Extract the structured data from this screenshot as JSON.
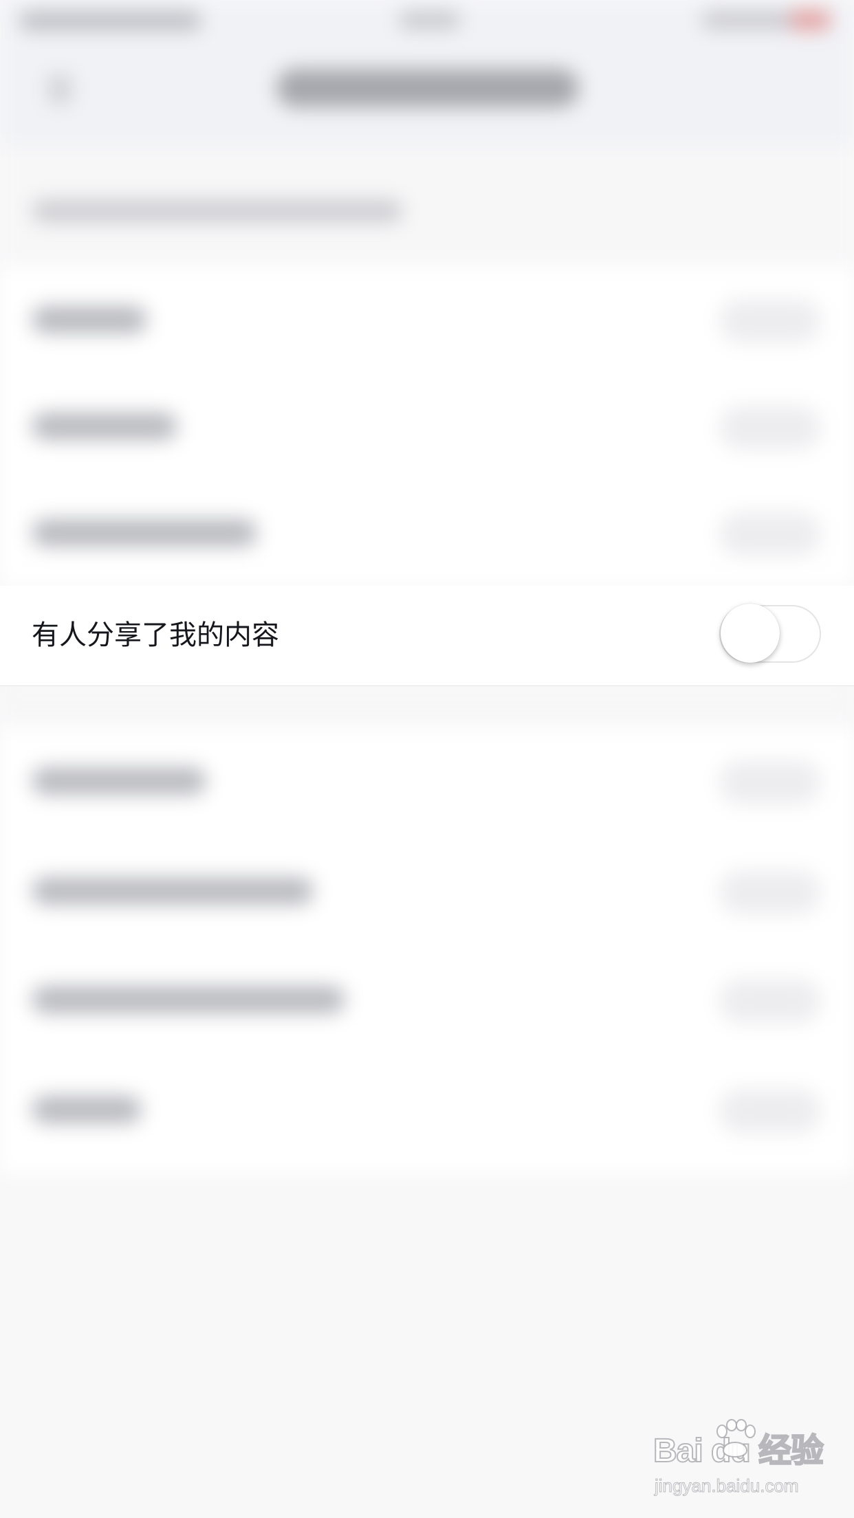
{
  "notification_setting": {
    "label": "有人分享了我的内容",
    "enabled": false
  },
  "watermark": {
    "brand": "Bai du 经验",
    "url": "jingyan.baidu.com"
  }
}
